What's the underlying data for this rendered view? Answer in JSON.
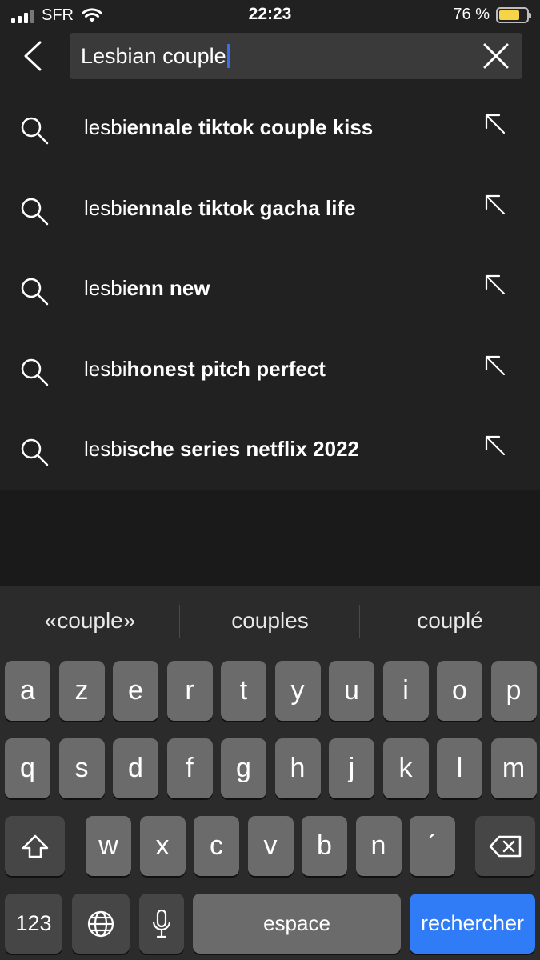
{
  "status_bar": {
    "carrier": "SFR",
    "time": "22:23",
    "battery_percent": "76 %",
    "battery_level": 0.76,
    "battery_color": "#f7d347"
  },
  "search": {
    "query": "Lesbian couple",
    "back_icon": "chevron-left-icon",
    "clear_icon": "close-icon"
  },
  "suggestions": [
    {
      "prefix": "lesbi",
      "rest": "ennale tiktok couple kiss"
    },
    {
      "prefix": "lesbi",
      "rest": "ennale tiktok gacha life"
    },
    {
      "prefix": "lesbi",
      "rest": "enn new"
    },
    {
      "prefix": "lesbi",
      "rest": "honest pitch perfect"
    },
    {
      "prefix": "lesbi",
      "rest": "sche series netflix 2022"
    }
  ],
  "keyboard": {
    "predictions": [
      "«couple»",
      "couples",
      "couplé"
    ],
    "row1": [
      "a",
      "z",
      "e",
      "r",
      "t",
      "y",
      "u",
      "i",
      "o",
      "p"
    ],
    "row2": [
      "q",
      "s",
      "d",
      "f",
      "g",
      "h",
      "j",
      "k",
      "l",
      "m"
    ],
    "row3": [
      "w",
      "x",
      "c",
      "v",
      "b",
      "n",
      "´"
    ],
    "numbers_label": "123",
    "space_label": "espace",
    "search_label": "rechercher",
    "accent_color": "#2f7cf6"
  }
}
